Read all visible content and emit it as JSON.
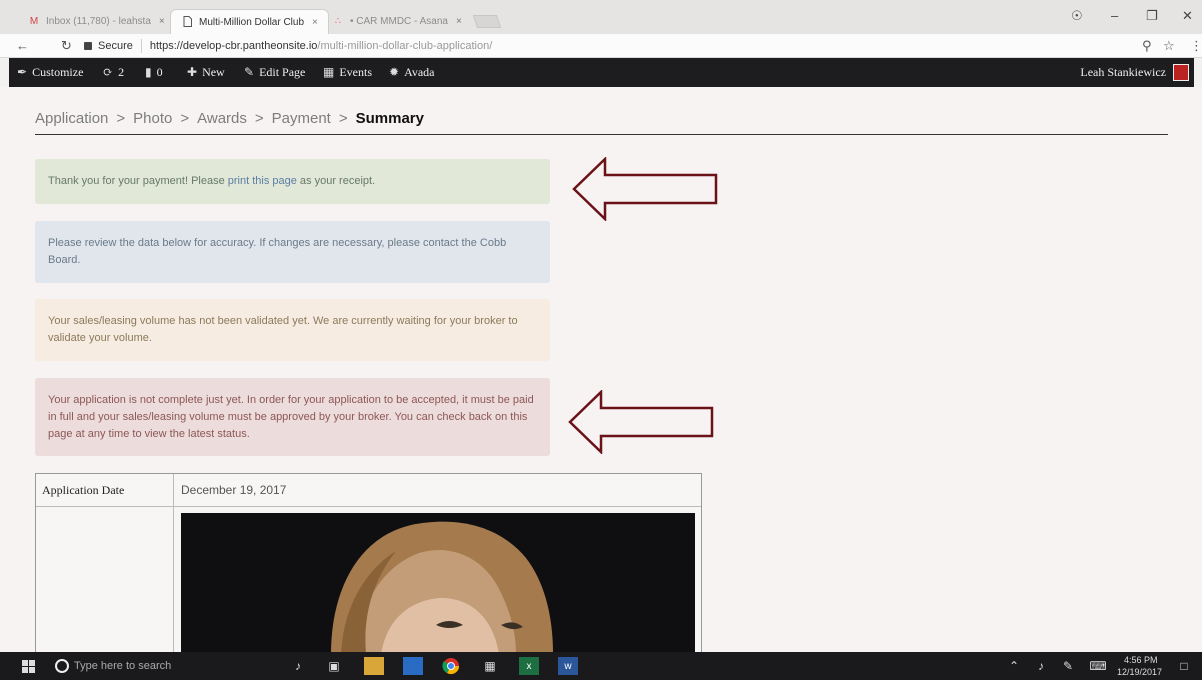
{
  "browser": {
    "tabs": [
      {
        "title": "Inbox (11,780) - leahsta",
        "icon": "gmail-icon",
        "active": false
      },
      {
        "title": "Multi-Million Dollar Club",
        "icon": "document-icon",
        "active": true
      },
      {
        "title": "• CAR MMDC - Asana",
        "icon": "asana-icon",
        "active": false
      }
    ],
    "close_glyph": "×",
    "security_label": "Secure",
    "url_host": "https://develop-cbr.pantheonsite.io",
    "url_path": "/multi-million-dollar-club-application/"
  },
  "adminbar": {
    "customize": "Customize",
    "updates_count": "2",
    "comments_count": "0",
    "new": "New",
    "edit_page": "Edit Page",
    "events": "Events",
    "avada": "Avada",
    "user": "Leah Stankiewicz"
  },
  "breadcrumb": {
    "items": [
      "Application",
      "Photo",
      "Awards",
      "Payment"
    ],
    "current": "Summary",
    "separator": ">"
  },
  "alerts": {
    "success_before": "Thank you for your payment! Please ",
    "success_link": "print this page",
    "success_after": " as your receipt.",
    "info": "Please review the data below for accuracy. If changes are necessary, please contact the Cobb Board.",
    "warning": "Your sales/leasing volume has not been validated yet. We are currently waiting for your broker to validate your volume.",
    "danger": "Your application is not complete just yet. In order for your application to be accepted, it must be paid in full and your sales/leasing volume must be approved by your broker. You can check back on this page at any time to view the latest status."
  },
  "table": {
    "application_date_label": "Application Date",
    "application_date_value": "December 19, 2017"
  },
  "taskbar": {
    "search_placeholder": "Type here to search",
    "time": "4:56 PM",
    "date": "12/19/2017"
  },
  "colors": {
    "admin_bar": "#1d1d1f",
    "arrow_outline": "#6b1218",
    "success_bg": "#e1e8d7",
    "info_bg": "#e1e6ec",
    "warning_bg": "#f6ece1",
    "danger_bg": "#ecdcdc"
  }
}
